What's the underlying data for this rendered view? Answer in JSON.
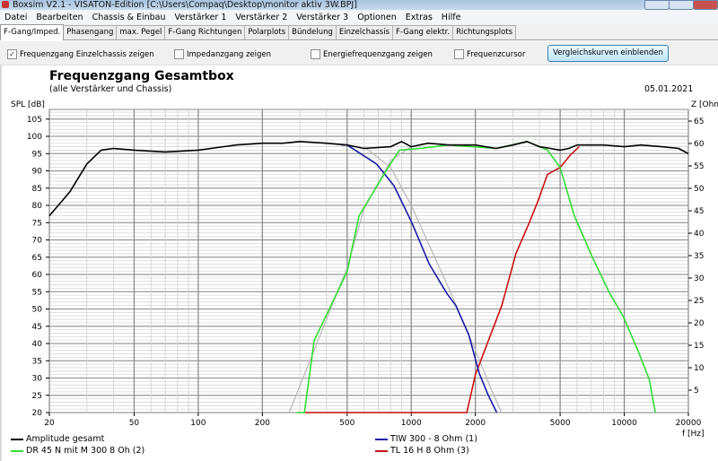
{
  "window": {
    "title": "Boxsim V2.1 - VISATON-Edition [C:\\Users\\Compaq\\Desktop\\monitor aktiv 3W.BPJ]"
  },
  "menu": [
    "Datei",
    "Bearbeiten",
    "Chassis & Einbau",
    "Verstärker 1",
    "Verstärker 2",
    "Verstärker 3",
    "Optionen",
    "Extras",
    "Hilfe"
  ],
  "tabs": [
    "F-Gang/Imped.",
    "Phasengang",
    "max. Pegel",
    "F-Gang Richtungen",
    "Polarplots",
    "Bündelung",
    "Einzelchassis",
    "F-Gang elektr.",
    "Richtungsplots"
  ],
  "active_tab": 0,
  "options": {
    "einzelchassis": {
      "label": "Frequenzgang Einzelchassis zeigen",
      "checked": true,
      "mark": "✓"
    },
    "impedanz": {
      "label": "Impedanzgang zeigen",
      "checked": false
    },
    "energie": {
      "label": "Energiefrequenzgang zeigen",
      "checked": false
    },
    "cursor": {
      "label": "Frequenzcursor",
      "checked": false
    },
    "vergleich_button": "Vergleichskurven einblenden"
  },
  "chart_data": {
    "type": "line",
    "title": "Frequenzgang Gesamtbox",
    "subtitle": "(alle Verstärker und Chassis)",
    "date": "05.01.2021",
    "xlabel": "f [Hz]",
    "ylabel": "SPL [dB]",
    "y2label": "Z [Ohm]",
    "xscale": "log",
    "xlim": [
      20,
      20000
    ],
    "ylim": [
      20,
      107.8
    ],
    "y2lim": [
      0,
      67.6
    ],
    "xticks": [
      "20",
      "50",
      "100",
      "200",
      "500",
      "1000",
      "2000",
      "5000",
      "10000",
      "20000"
    ],
    "yticks": [
      "20",
      "25",
      "30",
      "35",
      "40",
      "45",
      "50",
      "55",
      "60",
      "65",
      "70",
      "75",
      "80",
      "85",
      "90",
      "95",
      "100",
      "105"
    ],
    "y2ticks": [
      "5",
      "10",
      "15",
      "20",
      "25",
      "30",
      "35",
      "40",
      "45",
      "50",
      "55",
      "60",
      "65"
    ],
    "grid": true,
    "legend_position": "bottom",
    "series": [
      {
        "name": "Amplitude gesamt",
        "color": "#000000",
        "points": [
          [
            20,
            77
          ],
          [
            25,
            84
          ],
          [
            30,
            92
          ],
          [
            35,
            96
          ],
          [
            40,
            96.5
          ],
          [
            50,
            96
          ],
          [
            70,
            95.5
          ],
          [
            100,
            96
          ],
          [
            150,
            97.5
          ],
          [
            200,
            98
          ],
          [
            250,
            98
          ],
          [
            300,
            98.5
          ],
          [
            400,
            98
          ],
          [
            500,
            97.5
          ],
          [
            600,
            96.5
          ],
          [
            800,
            97
          ],
          [
            900,
            98.5
          ],
          [
            1000,
            97
          ],
          [
            1200,
            98
          ],
          [
            1500,
            97.5
          ],
          [
            2000,
            97.5
          ],
          [
            2500,
            96.5
          ],
          [
            3000,
            97.5
          ],
          [
            3500,
            98.5
          ],
          [
            4000,
            97
          ],
          [
            4500,
            96.5
          ],
          [
            5000,
            96
          ],
          [
            5500,
            96.5
          ],
          [
            6000,
            97.5
          ],
          [
            8000,
            97.5
          ],
          [
            10000,
            97
          ],
          [
            12000,
            97.5
          ],
          [
            15000,
            97
          ],
          [
            18000,
            96.5
          ],
          [
            20000,
            95
          ]
        ]
      },
      {
        "name": "TIW 300 - 8 Ohm (1)",
        "color": "#1a1aa8",
        "points": [
          [
            470,
            97.5
          ],
          [
            500,
            97.5
          ],
          [
            687,
            92
          ],
          [
            830,
            85.7
          ],
          [
            1007,
            75
          ],
          [
            1215,
            63
          ],
          [
            1470,
            54.5
          ],
          [
            1620,
            51
          ],
          [
            1860,
            42.6
          ],
          [
            2090,
            31.2
          ],
          [
            2300,
            25
          ],
          [
            2520,
            20
          ]
        ]
      },
      {
        "name": "DR 45 N mit M 300 8 Oh (2)",
        "color": "#33dd33",
        "points": [
          [
            290,
            20
          ],
          [
            315,
            20
          ],
          [
            350,
            40.8
          ],
          [
            500,
            60.8
          ],
          [
            569,
            77
          ],
          [
            761,
            90
          ],
          [
            880,
            96
          ],
          [
            1140,
            96.6
          ],
          [
            1500,
            97.5
          ],
          [
            2500,
            96.5
          ],
          [
            3500,
            98.5
          ],
          [
            4360,
            96
          ],
          [
            5000,
            91
          ],
          [
            5830,
            77
          ],
          [
            7080,
            65
          ],
          [
            8550,
            54.5
          ],
          [
            9900,
            47.8
          ],
          [
            11700,
            37.4
          ],
          [
            13100,
            29.6
          ],
          [
            14000,
            20
          ]
        ]
      },
      {
        "name": "TL 16 H 8 Ohm (3)",
        "color": "#cc1111",
        "points": [
          [
            315,
            20
          ],
          [
            1823,
            20
          ],
          [
            2000,
            31
          ],
          [
            2660,
            51
          ],
          [
            3100,
            66
          ],
          [
            3580,
            75
          ],
          [
            3950,
            81.5
          ],
          [
            4360,
            89
          ],
          [
            5000,
            91
          ],
          [
            5560,
            94.5
          ],
          [
            6140,
            97
          ]
        ]
      },
      {
        "name": "",
        "color": "#b8b8b8",
        "points": [
          [
            267,
            20
          ],
          [
            350,
            38
          ],
          [
            500,
            62
          ],
          [
            600,
            79
          ],
          [
            800,
            93
          ],
          [
            1000,
            97
          ]
        ]
      },
      {
        "name": "",
        "color": "#b8b8b8",
        "points": [
          [
            600,
            97
          ],
          [
            800,
            91
          ],
          [
            1000,
            80
          ],
          [
            1500,
            56
          ],
          [
            2000,
            38
          ],
          [
            2400,
            26
          ],
          [
            2650,
            20
          ]
        ]
      }
    ]
  }
}
